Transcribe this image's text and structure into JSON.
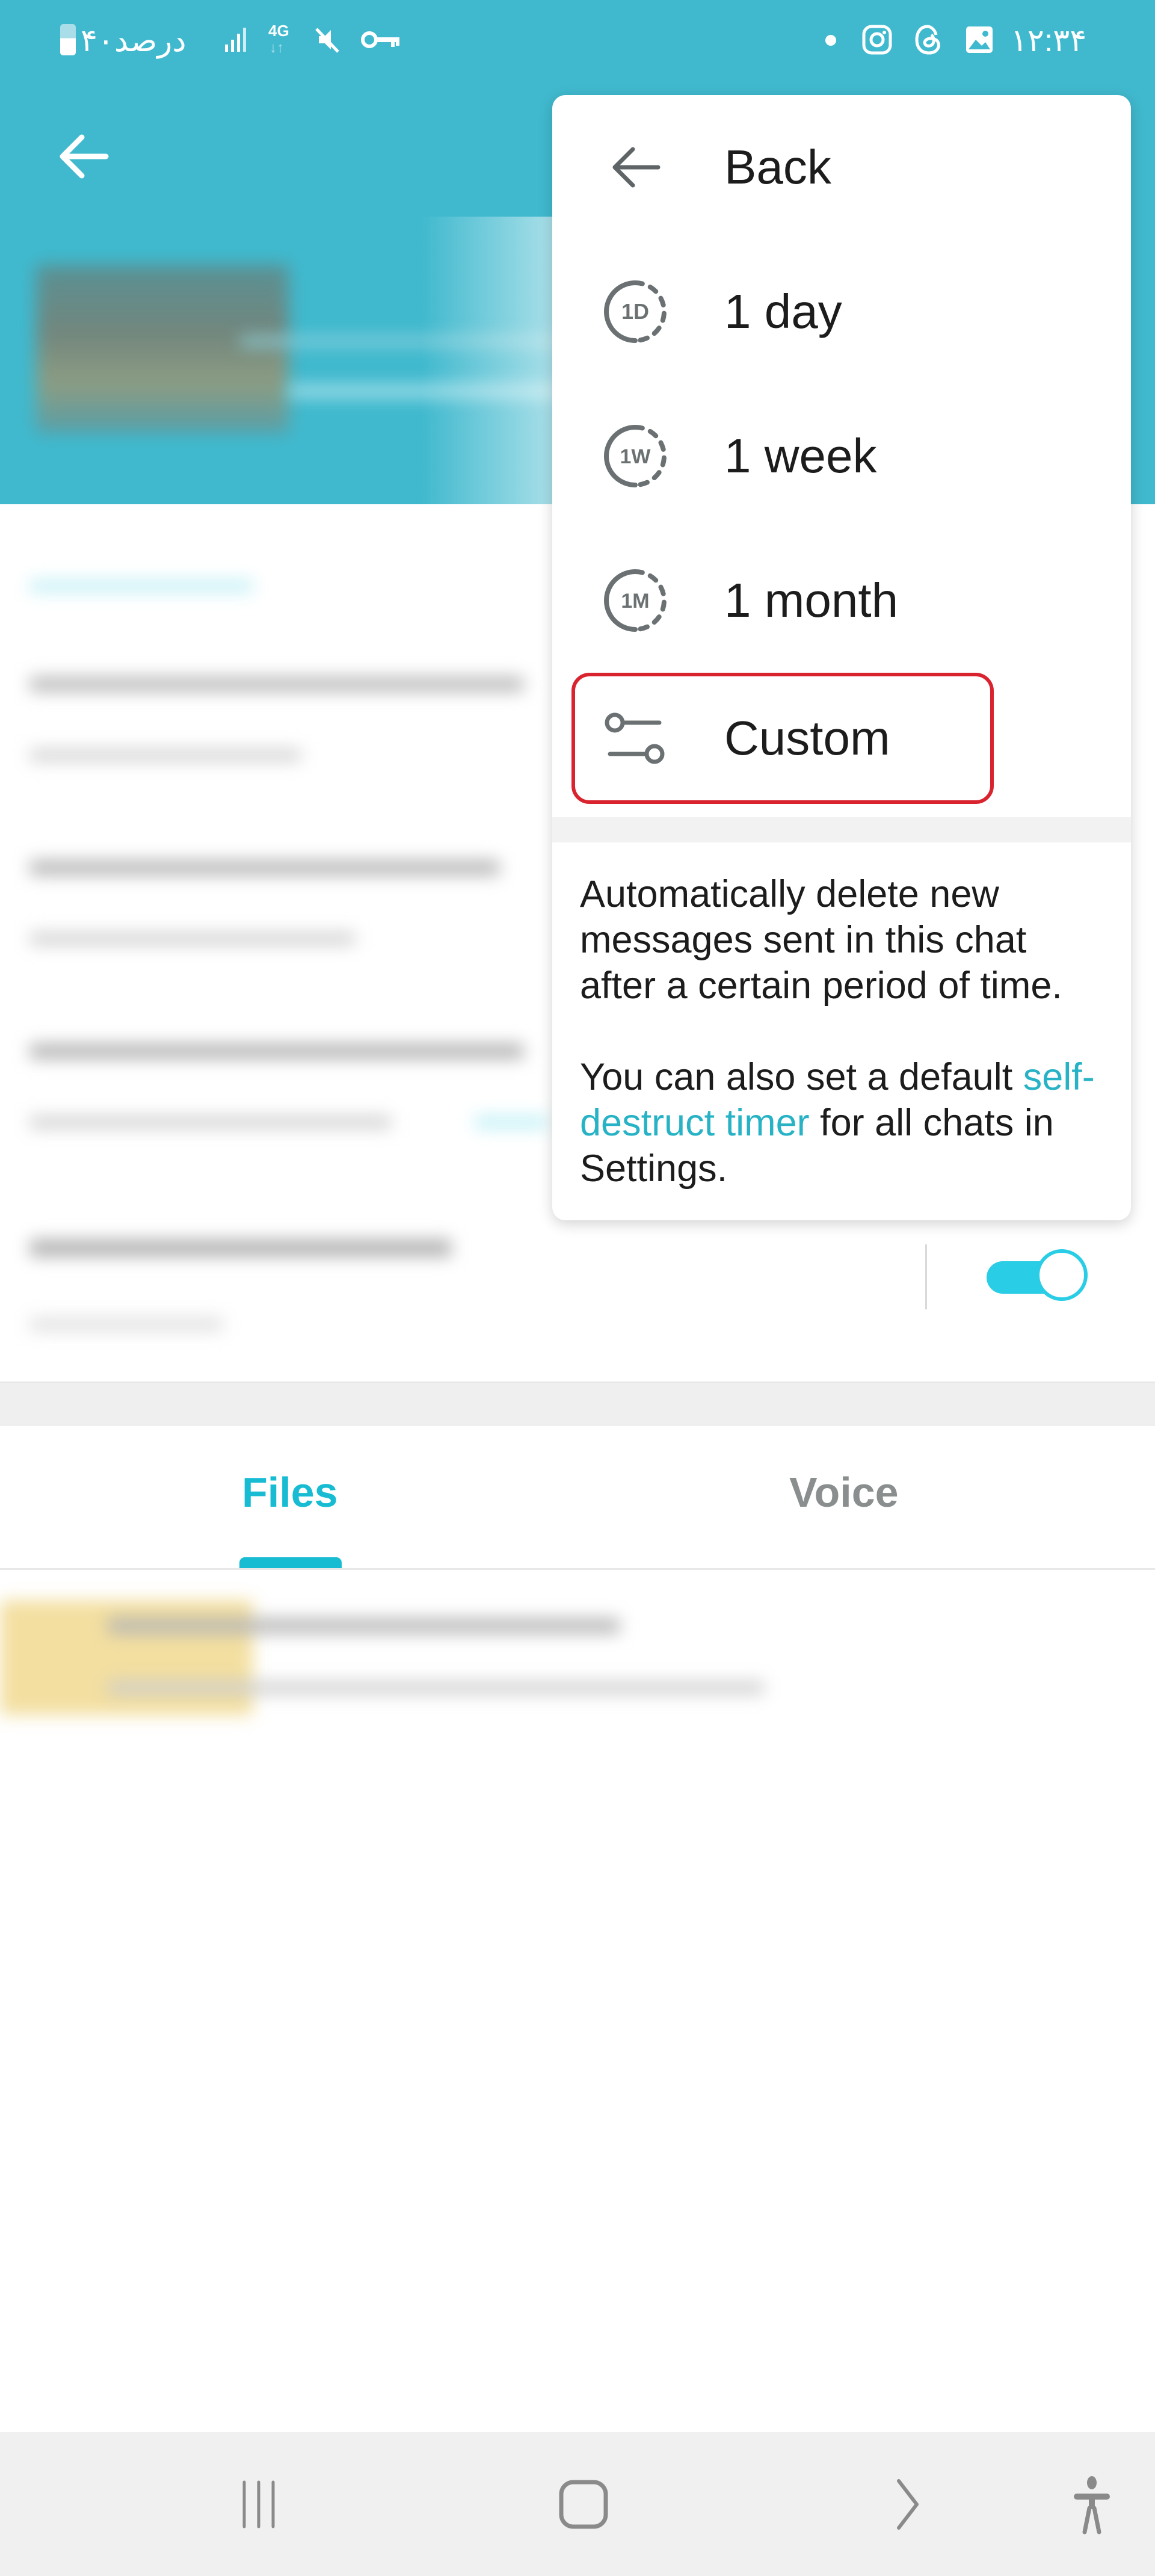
{
  "status_bar": {
    "time": "۱۲:۳۴",
    "battery_text": "۴۰درصد",
    "network": "4G",
    "left_icons": [
      "battery-icon",
      "signal-icon",
      "network-4g-icon",
      "mute-icon",
      "vpn-key-icon"
    ],
    "right_icons": [
      "notification-dot-icon",
      "instagram-icon",
      "threads-icon",
      "gallery-icon"
    ]
  },
  "header": {
    "back_icon": "arrow-left-icon"
  },
  "menu": {
    "items": [
      {
        "label": "Back",
        "icon": "arrow-left-icon"
      },
      {
        "label": "1 day",
        "icon": "timer-1d-icon",
        "icon_text": "1D"
      },
      {
        "label": "1 week",
        "icon": "timer-1w-icon",
        "icon_text": "1W"
      },
      {
        "label": "1 month",
        "icon": "timer-1m-icon",
        "icon_text": "1M"
      },
      {
        "label": "Custom",
        "icon": "sliders-icon",
        "highlighted": true
      }
    ],
    "description": {
      "paragraph1": "Automatically delete new messages sent in this chat after a certain period of time.",
      "paragraph2_before": "You can also set a default ",
      "paragraph2_link": "self-destruct timer",
      "paragraph2_after": " for all chats in Settings."
    }
  },
  "settings": {
    "toggle_on": true
  },
  "tabs": [
    {
      "label": "Files",
      "active": true
    },
    {
      "label": "Voice",
      "active": false
    }
  ],
  "colors": {
    "header": "#40b9ce",
    "accent": "#17bcd3",
    "highlight_border": "#d9232f",
    "link": "#27b3c5"
  },
  "navbar": {
    "buttons": [
      "recent-apps-icon",
      "home-icon",
      "back-icon",
      "accessibility-icon"
    ]
  }
}
